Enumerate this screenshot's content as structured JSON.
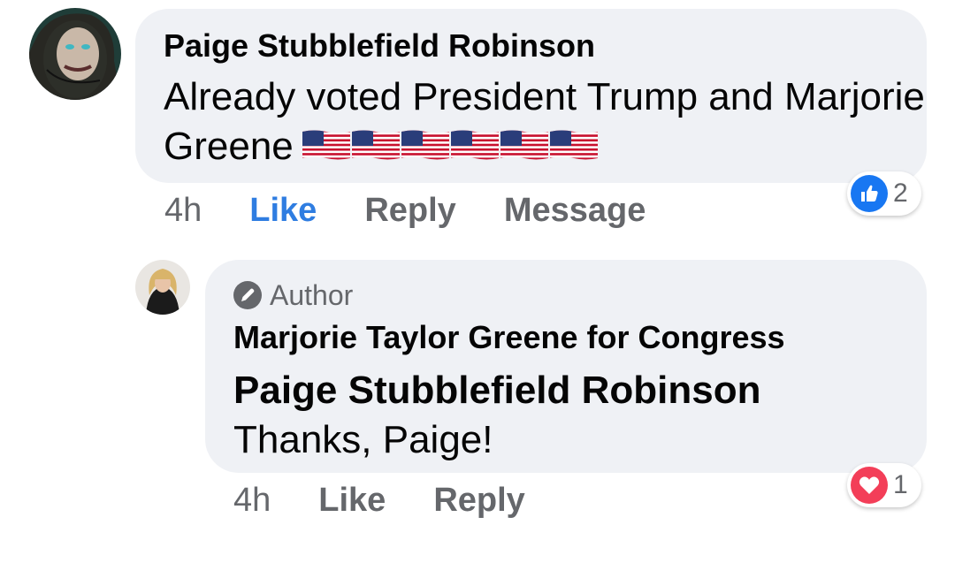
{
  "comment": {
    "author": "Paige Stubblefield Robinson",
    "text": "Already voted President Trump and Marjorie Greene",
    "flags_icon": "us-flag-icon",
    "flags_count": 6,
    "time": "4h",
    "like_label": "Like",
    "reply_label": "Reply",
    "message_label": "Message",
    "reaction_icon": "like-icon",
    "reaction_count": "2",
    "like_color": "#2f7de1"
  },
  "reply": {
    "badge_label": "Author",
    "author": "Marjorie Taylor Greene for Congress",
    "mention": "Paige Stubblefield Robinson",
    "text": " Thanks, Paige!",
    "time": "4h",
    "like_label": "Like",
    "reply_label": "Reply",
    "reaction_icon": "love-icon",
    "reaction_count": "1"
  },
  "colors": {
    "bubble": "#eff1f5",
    "secondary_text": "#65676b",
    "like_reaction": "#1877f2",
    "love_reaction": "#f33e58"
  }
}
